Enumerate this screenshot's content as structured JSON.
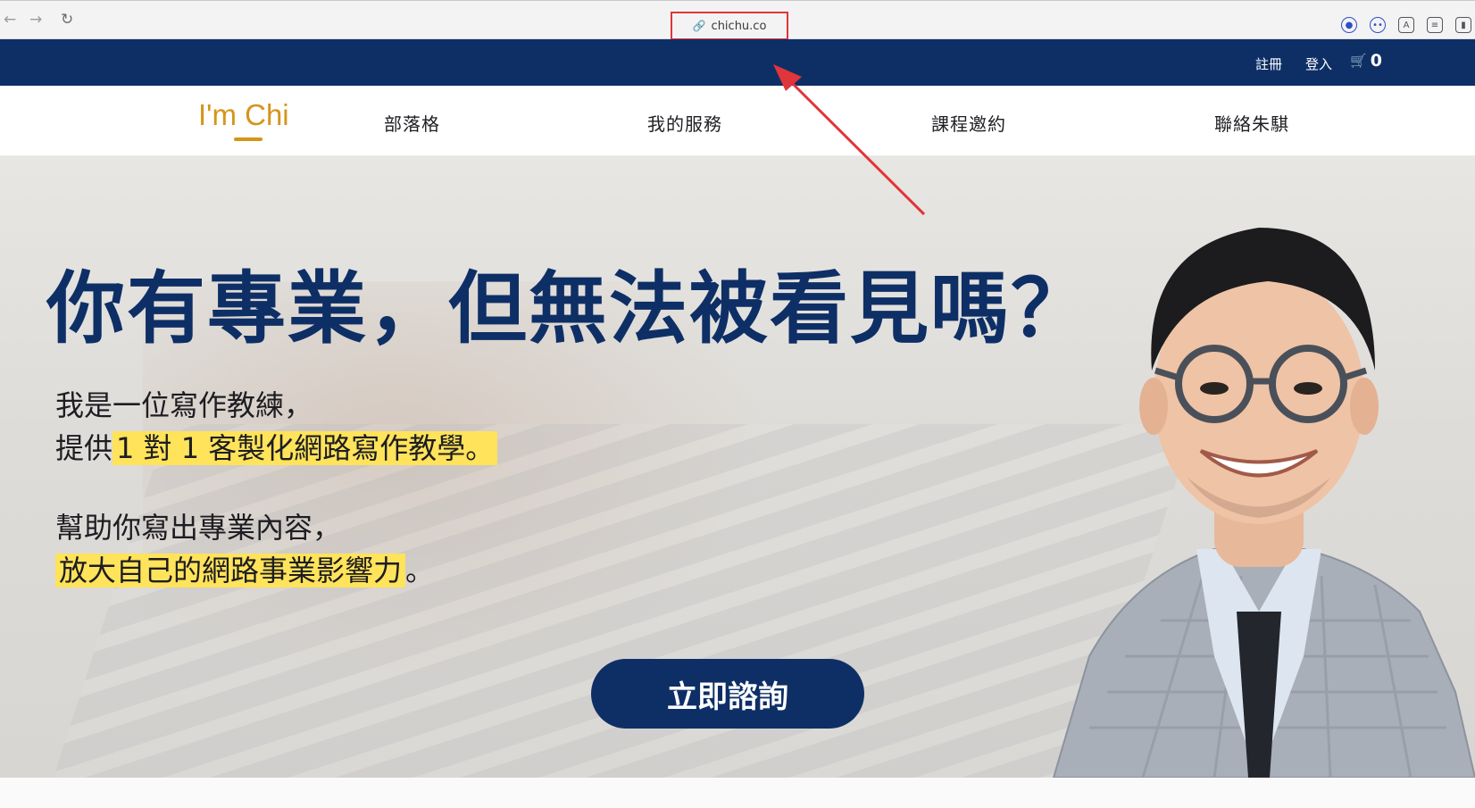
{
  "browser": {
    "url": "chichu.co",
    "icons": [
      "back-arrow-icon",
      "forward-arrow-icon",
      "reload-icon",
      "link-icon",
      "password-key-icon",
      "face-icon",
      "translate-icon",
      "list-icon",
      "sidebar-icon"
    ]
  },
  "topbar": {
    "signup": "註冊",
    "login": "登入",
    "cart_count": "0"
  },
  "nav": {
    "logo": "I'm Chi",
    "items": [
      "部落格",
      "我的服務",
      "課程邀約",
      "聯絡朱騏"
    ]
  },
  "hero": {
    "headline": "你有專業，但無法被看見嗎？",
    "para1_line1": "我是一位寫作教練，",
    "para1_line2_prefix": "提供",
    "para1_line2_highlight": "1 對 1 客製化網路寫作教學。",
    "para2_line1": "幫助你寫出專業內容，",
    "para2_line2_highlight": "放大自己的網路事業影響力",
    "para2_line2_suffix": "。",
    "cta": "立即諮詢"
  },
  "colors": {
    "brand_navy": "#0e2f66",
    "logo_gold": "#d4951a",
    "highlight_yellow": "#ffe35a",
    "annotation_red": "#e0353a"
  }
}
